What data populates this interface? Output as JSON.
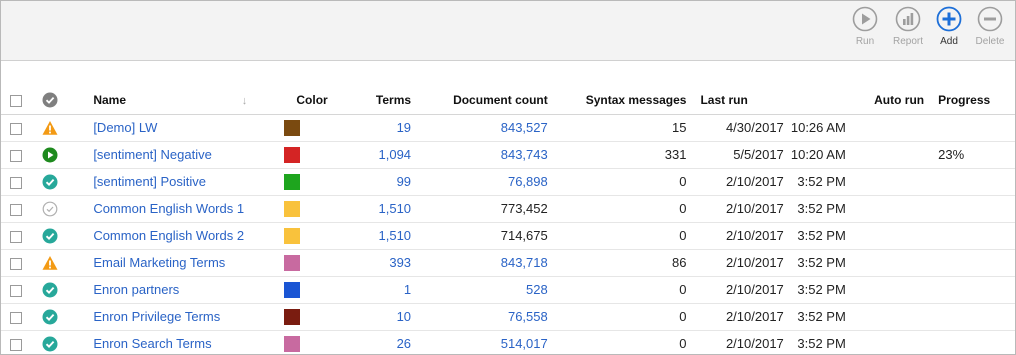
{
  "toolbar": {
    "run_label": "Run",
    "report_label": "Report",
    "add_label": "Add",
    "delete_label": "Delete"
  },
  "table": {
    "headers": {
      "name": "Name",
      "color": "Color",
      "terms": "Terms",
      "document_count": "Document count",
      "syntax_messages": "Syntax messages",
      "last_run": "Last run",
      "auto_run": "Auto run",
      "progress": "Progress"
    },
    "rows": [
      {
        "status": "warning",
        "name": "[Demo] LW",
        "color": "#7a4a10",
        "terms": "19",
        "doc_count": "843,527",
        "doc_count_link": true,
        "syntax": "15",
        "last_date": "4/30/2017",
        "last_time": "10:26 AM",
        "auto_run": "",
        "progress": ""
      },
      {
        "status": "running",
        "name": "[sentiment] Negative",
        "color": "#d42424",
        "terms": "1,094",
        "doc_count": "843,743",
        "doc_count_link": true,
        "syntax": "331",
        "last_date": "5/5/2017",
        "last_time": "10:20 AM",
        "auto_run": "",
        "progress": "23%"
      },
      {
        "status": "ok",
        "name": "[sentiment] Positive",
        "color": "#1ea51e",
        "terms": "99",
        "doc_count": "76,898",
        "doc_count_link": true,
        "syntax": "0",
        "last_date": "2/10/2017",
        "last_time": "3:52 PM",
        "auto_run": "",
        "progress": ""
      },
      {
        "status": "pending",
        "name": "Common English Words 1",
        "color": "#f9c23c",
        "terms": "1,510",
        "doc_count": "773,452",
        "doc_count_link": false,
        "syntax": "0",
        "last_date": "2/10/2017",
        "last_time": "3:52 PM",
        "auto_run": "",
        "progress": ""
      },
      {
        "status": "ok",
        "name": "Common English Words 2",
        "color": "#f9c23c",
        "terms": "1,510",
        "doc_count": "714,675",
        "doc_count_link": false,
        "syntax": "0",
        "last_date": "2/10/2017",
        "last_time": "3:52 PM",
        "auto_run": "",
        "progress": ""
      },
      {
        "status": "warning",
        "name": "Email Marketing Terms",
        "color": "#c86aa0",
        "terms": "393",
        "doc_count": "843,718",
        "doc_count_link": true,
        "syntax": "86",
        "last_date": "2/10/2017",
        "last_time": "3:52 PM",
        "auto_run": "",
        "progress": ""
      },
      {
        "status": "ok",
        "name": "Enron partners",
        "color": "#1a55d4",
        "terms": "1",
        "doc_count": "528",
        "doc_count_link": true,
        "syntax": "0",
        "last_date": "2/10/2017",
        "last_time": "3:52 PM",
        "auto_run": "",
        "progress": ""
      },
      {
        "status": "ok",
        "name": "Enron Privilege Terms",
        "color": "#7a1c10",
        "terms": "10",
        "doc_count": "76,558",
        "doc_count_link": true,
        "syntax": "0",
        "last_date": "2/10/2017",
        "last_time": "3:52 PM",
        "auto_run": "",
        "progress": ""
      },
      {
        "status": "ok",
        "name": "Enron Search Terms",
        "color": "#c86aa0",
        "terms": "26",
        "doc_count": "514,017",
        "doc_count_link": true,
        "syntax": "0",
        "last_date": "2/10/2017",
        "last_time": "3:52 PM",
        "auto_run": "",
        "progress": ""
      }
    ]
  },
  "colors": {
    "link": "#2a63c6",
    "ok": "#27a89a",
    "running": "#1e8a1e",
    "warning": "#f39a14",
    "pending": "#b0b0b0",
    "add_accent": "#1d6fd8",
    "toolbar_disabled": "#a3a3a3"
  },
  "icons": {
    "run": "play-circle-icon",
    "report": "bar-chart-circle-icon",
    "add": "plus-circle-icon",
    "delete": "minus-circle-icon",
    "header_status": "check-circle-icon",
    "sort": "sort-down-arrow-icon"
  }
}
